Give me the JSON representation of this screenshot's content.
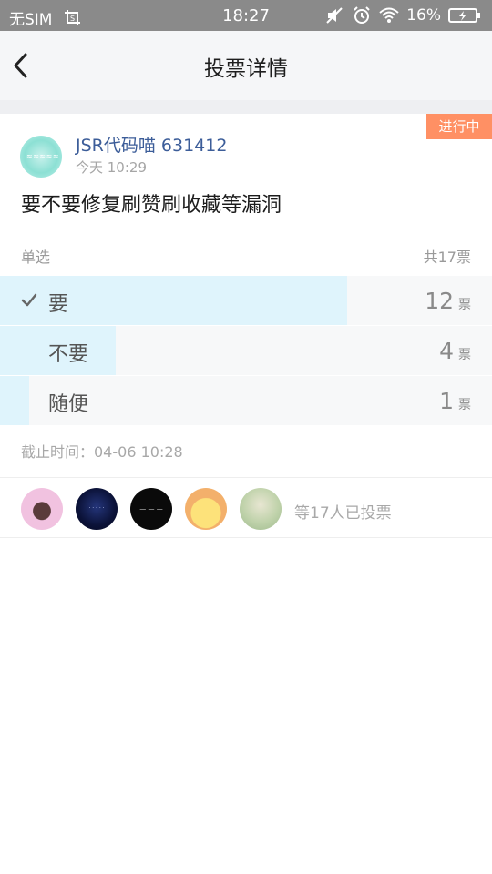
{
  "status_bar": {
    "carrier": "无SIM",
    "time": "18:27",
    "battery_percent": "16%",
    "icons": [
      "screenshot-icon",
      "mute-icon",
      "alarm-icon",
      "wifi-icon",
      "battery-charging-icon"
    ]
  },
  "nav": {
    "title": "投票详情",
    "back_icon": "back-arrow-icon"
  },
  "post": {
    "status_tag": "进行中",
    "author_name": "JSR代码喵 631412",
    "time": "今天 10:29",
    "title": "要不要修复刷赞刷收藏等漏洞",
    "vote_type": "单选",
    "total_votes": "共17票",
    "options": [
      {
        "label": "要",
        "count": "12",
        "unit": "票",
        "selected": true,
        "share": 0.706
      },
      {
        "label": "不要",
        "count": "4",
        "unit": "票",
        "selected": false,
        "share": 0.235
      },
      {
        "label": "随便",
        "count": "1",
        "unit": "票",
        "selected": false,
        "share": 0.059
      }
    ],
    "deadline": "截止时间：04-06 10:28",
    "voters_summary": "等17人已投票",
    "voters": [
      {
        "name": "voter-avatar-1"
      },
      {
        "name": "voter-avatar-2"
      },
      {
        "name": "voter-avatar-3"
      },
      {
        "name": "voter-avatar-4"
      },
      {
        "name": "voter-avatar-5"
      }
    ]
  },
  "colors": {
    "status_tag": "#ff9064",
    "author_name": "#3c5d99",
    "vote_fill": "#dff4fc",
    "option_bg": "#f7f8f9"
  }
}
